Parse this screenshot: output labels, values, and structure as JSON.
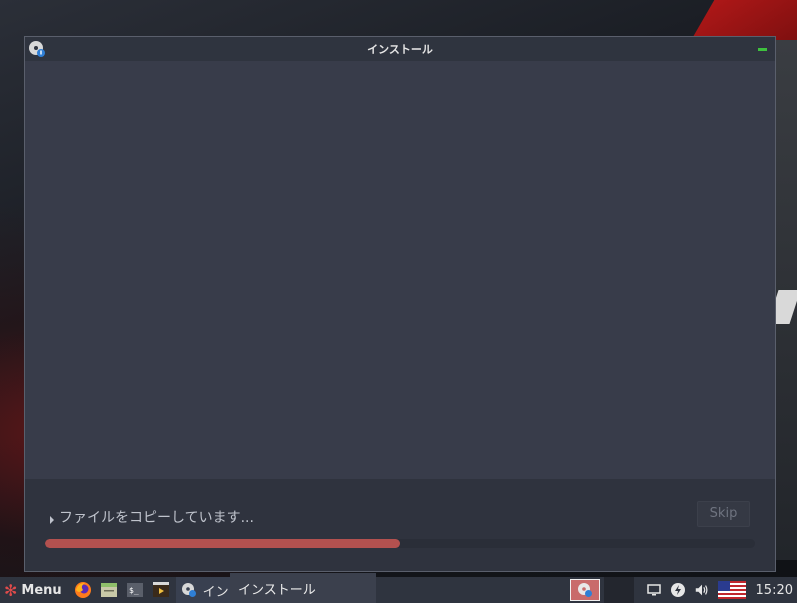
{
  "window": {
    "title": "インストール",
    "status_text": "ファイルをコピーしています...",
    "skip_label": "Skip",
    "progress_fraction": 0.5
  },
  "taskbar": {
    "menu_label": "Menu",
    "task_label": "イン",
    "tooltip": "インストール",
    "clock": "15:20"
  },
  "colors": {
    "window_bg": "#383c4a",
    "progress_fill": "#b3514f",
    "taskbar_bg": "#2f343f"
  },
  "icons": {
    "app": "disc-install-icon",
    "menu": "menu-logo-icon",
    "firefox": "firefox-icon",
    "files": "file-manager-icon",
    "terminal": "terminal-icon",
    "media": "media-player-icon",
    "tray_display": "display-icon",
    "tray_update": "update-icon",
    "volume": "volume-icon",
    "keyboard": "us-flag-icon"
  }
}
